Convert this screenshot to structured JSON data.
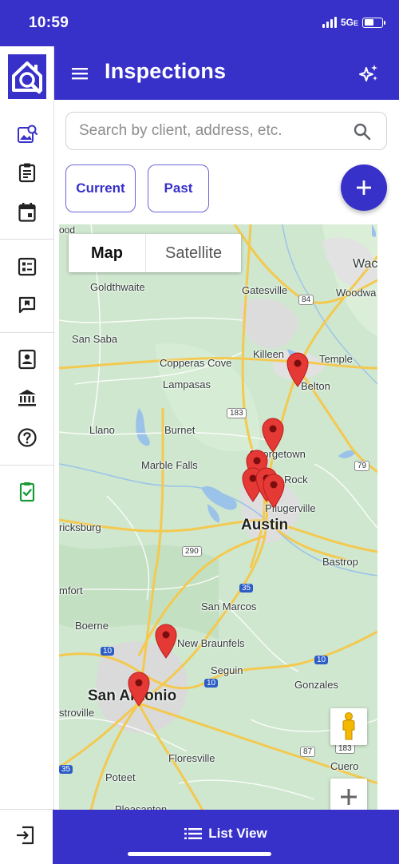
{
  "status_bar": {
    "time": "10:59",
    "network": "5G",
    "network_suffix": "E"
  },
  "header": {
    "title": "Inspections",
    "menu_icon": "hamburger-icon",
    "action_icon": "sparkle-icon"
  },
  "side_rail": {
    "icons": [
      "app-logo",
      "photo-search-icon",
      "clipboard-icon",
      "calendar-icon",
      "checklist-icon",
      "feedback-icon",
      "contacts-icon",
      "bank-icon",
      "help-icon",
      "checkbook-icon",
      "logout-icon"
    ]
  },
  "search": {
    "placeholder": "Search by client, address, etc.",
    "value": ""
  },
  "filters": {
    "current_label": "Current",
    "past_label": "Past"
  },
  "fab": {
    "icon": "plus-icon"
  },
  "map": {
    "view_toggle": {
      "map_label": "Map",
      "satellite_label": "Satellite",
      "selected": "Map"
    },
    "labels": {
      "goldthwaite": "Goldthwaite",
      "gatesville": "Gatesville",
      "woodway": "Woodwa",
      "waco": "Wac",
      "san_saba": "San Saba",
      "killeen": "Killeen",
      "temple": "Temple",
      "copperas_cove": "Copperas Cove",
      "lampasas": "Lampasas",
      "belton": "Belton",
      "llano": "Llano",
      "burnet": "Burnet",
      "georgetown": "Georgetown",
      "marble_falls": "Marble Falls",
      "round_rock": "Rock",
      "pflugerville": "Pflugerville",
      "austin": "Austin",
      "fredericksburg": "ricksburg",
      "bastrop": "Bastrop",
      "comfort": "mfort",
      "san_marcos": "San Marcos",
      "boerne": "Boerne",
      "new_braunfels": "New Braunfels",
      "seguin": "Seguin",
      "gonzales": "Gonzales",
      "san_antonio": "San Antonio",
      "castroville": "stroville",
      "floresville": "Floresville",
      "poteet": "Poteet",
      "cuero": "Cuero",
      "pleasanton": "Pleasanton",
      "fosl": "ood"
    },
    "highways": [
      "84",
      "183",
      "79",
      "290",
      "35",
      "10",
      "10",
      "10",
      "87",
      "183",
      "35"
    ],
    "controls": {
      "pegman_icon": "pegman-icon",
      "zoom_in_icon": "zoom-in-icon"
    },
    "pin_count": 8
  },
  "bottom_bar": {
    "label": "List View",
    "icon": "list-icon"
  },
  "colors": {
    "brand": "#3730c9",
    "pin": "#e53935",
    "map_land": "#cfe7cf",
    "road": "#f3c94f"
  }
}
